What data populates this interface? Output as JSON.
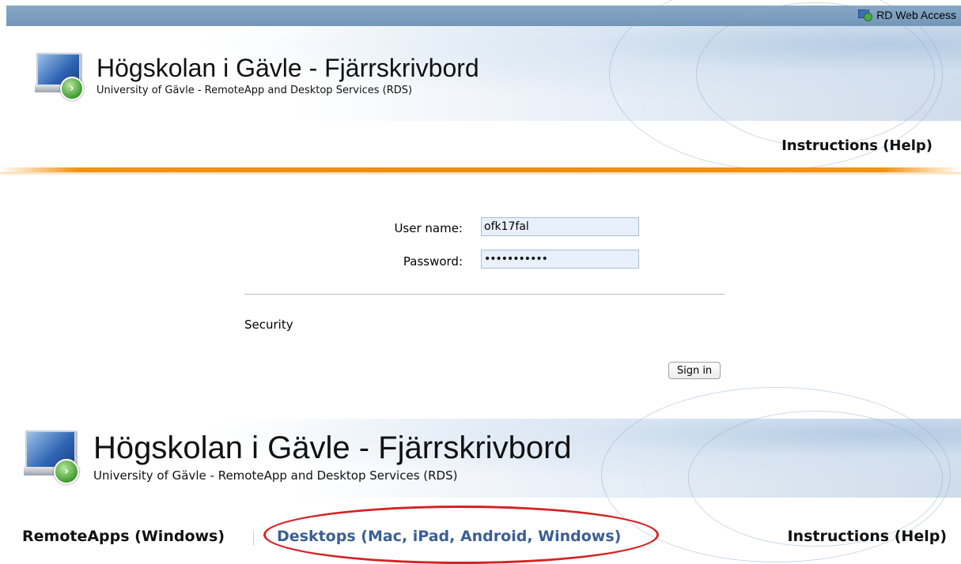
{
  "topbar": {
    "app_label": "RD Web Access",
    "icon": "rd-web-access-icon"
  },
  "header": {
    "title": "Högskolan i Gävle - Fjärrskrivbord",
    "subtitle": "University of Gävle - RemoteApp and Desktop Services (RDS)",
    "logo_icon": "remote-desktop-logo-icon",
    "help_link": "Instructions (Help)"
  },
  "login": {
    "username_label": "User name:",
    "username_value": "ofk17fal",
    "password_label": "Password:",
    "password_value": "•••••••••••",
    "security_label": "Security",
    "signin_button": "Sign in"
  },
  "header2": {
    "title": "Högskolan i Gävle - Fjärrskrivbord",
    "subtitle": "University of Gävle - RemoteApp and Desktop Services (RDS)",
    "logo_icon": "remote-desktop-logo-icon"
  },
  "nav": {
    "remoteapps": "RemoteApps (Windows)",
    "desktops": "Desktops (Mac, iPad, Android, Windows)",
    "help": "Instructions (Help)"
  },
  "colors": {
    "accent_orange": "#f08c00",
    "topbar_blue": "#7d9fbf",
    "link_blue": "#3a5f95",
    "highlight_red": "#d42323"
  }
}
